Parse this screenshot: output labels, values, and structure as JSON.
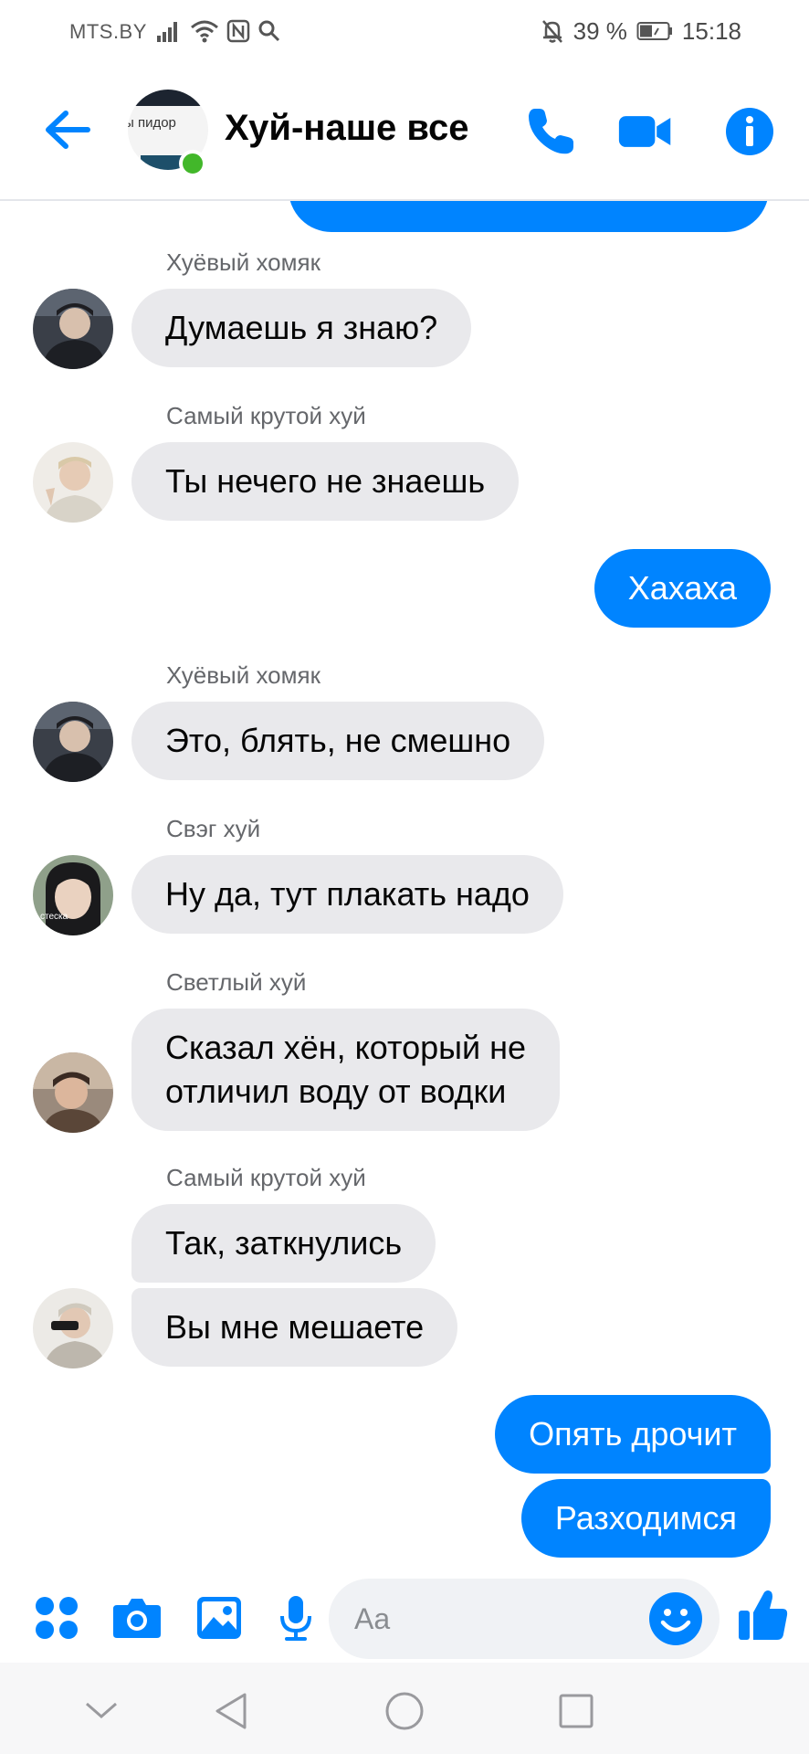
{
  "status_bar": {
    "carrier": "MTS.BY",
    "battery": "39 %",
    "time": "15:18"
  },
  "header": {
    "title": "Хуй-наше все",
    "avatar_caption": "ы пидор",
    "accent_color": "#0084ff",
    "online_color": "#42b72a"
  },
  "messages": [
    {
      "sender": "Хуёвый хомяк",
      "text": "Думаешь я знаю?"
    },
    {
      "sender": "Самый крутой хуй",
      "text": "Ты нечего не знаешь"
    },
    {
      "outgoing": true,
      "text": "Хахаха"
    },
    {
      "sender": "Хуёвый хомяк",
      "text": "Это, блять, не смешно"
    },
    {
      "sender": "Свэг хуй",
      "text": "Ну да, тут плакать надо",
      "avatar_caption": "стеска"
    },
    {
      "sender": "Светлый хуй",
      "lines": [
        "Сказал хён, который не",
        "отличил воду от водки"
      ]
    },
    {
      "sender": "Самый крутой хуй",
      "texts": [
        "Так, заткнулись",
        "Вы мне мешаете"
      ]
    },
    {
      "outgoing": true,
      "texts": [
        "Опять дрочит",
        "Разходимся"
      ]
    }
  ],
  "composer": {
    "placeholder": "Aa"
  }
}
